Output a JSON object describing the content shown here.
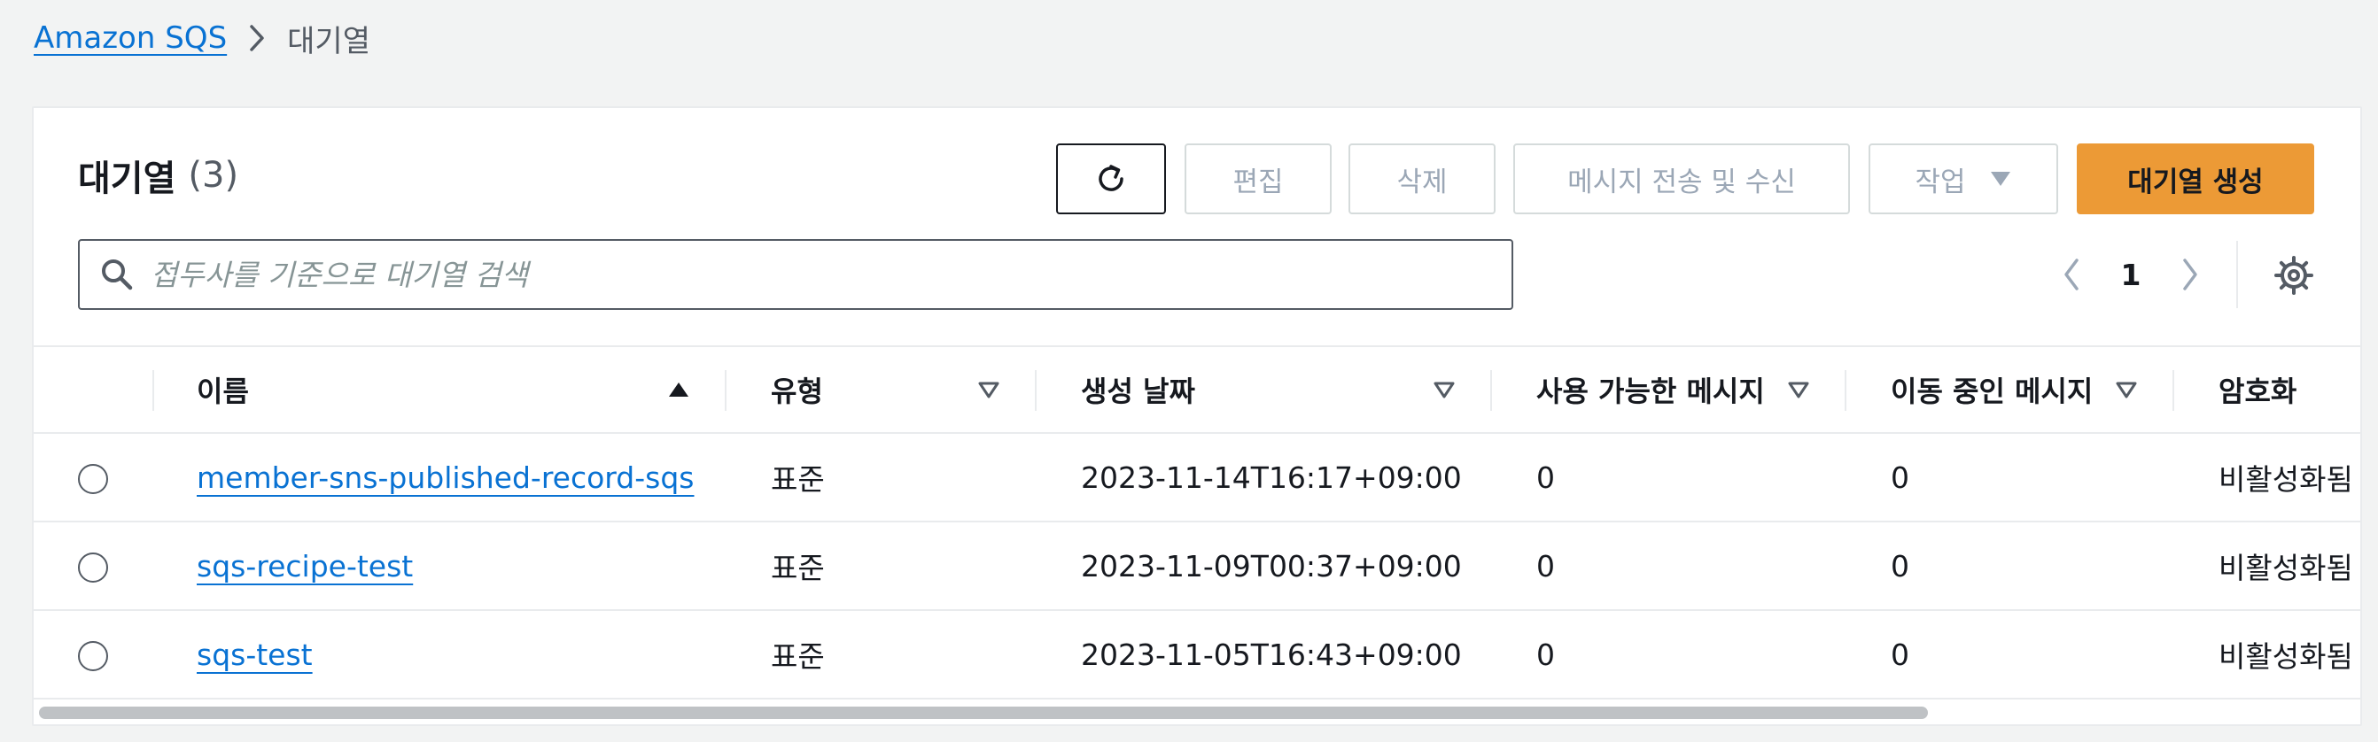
{
  "breadcrumb": {
    "root": "Amazon SQS",
    "current": "대기열"
  },
  "header": {
    "title": "대기열",
    "count": "(3)"
  },
  "toolbar": {
    "edit_label": "편집",
    "delete_label": "삭제",
    "send_receive_label": "메시지 전송 및 수신",
    "actions_label": "작업",
    "create_label": "대기열 생성"
  },
  "search": {
    "placeholder": "접두사를 기준으로 대기열 검색",
    "value": ""
  },
  "pagination": {
    "current_page": "1"
  },
  "table": {
    "columns": {
      "name": "이름",
      "type": "유형",
      "created": "생성 날짜",
      "available": "사용 가능한 메시지",
      "in_flight": "이동 중인 메시지",
      "encryption": "암호화"
    },
    "rows": [
      {
        "name": "member-sns-published-record-sqs",
        "type": "표준",
        "created": "2023-11-14T16:17+09:00",
        "available": "0",
        "in_flight": "0",
        "encryption": "비활성화됨"
      },
      {
        "name": "sqs-recipe-test",
        "type": "표준",
        "created": "2023-11-09T00:37+09:00",
        "available": "0",
        "in_flight": "0",
        "encryption": "비활성화됨"
      },
      {
        "name": "sqs-test",
        "type": "표준",
        "created": "2023-11-05T16:43+09:00",
        "available": "0",
        "in_flight": "0",
        "encryption": "비활성화됨"
      }
    ]
  },
  "icons": {
    "refresh": "refresh-icon",
    "search": "search-icon",
    "settings": "gear-icon",
    "sort_asc": "caret-up-filled-icon",
    "sort_none": "caret-down-outline-icon"
  },
  "colors": {
    "link": "#0972d3",
    "primary_button": "#ec9a36",
    "disabled_text": "#9ba7b6"
  }
}
